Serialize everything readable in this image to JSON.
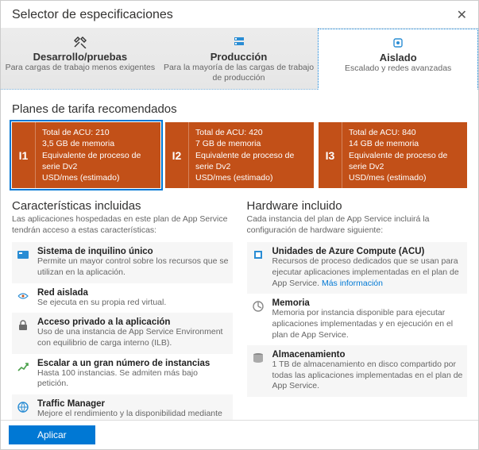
{
  "title": "Selector de especificaciones",
  "tabs": [
    {
      "title": "Desarrollo/pruebas",
      "sub": "Para cargas de trabajo menos exigentes"
    },
    {
      "title": "Producción",
      "sub": "Para la mayoría de las cargas de trabajo de producción"
    },
    {
      "title": "Aislado",
      "sub": "Escalado y redes avanzadas"
    }
  ],
  "recommended_heading": "Planes de tarifa recomendados",
  "plans": [
    {
      "code": "I1",
      "l1": "Total de ACU: 210",
      "l2": "3,5 GB de memoria",
      "l3": "Equivalente de proceso de serie Dv2",
      "l4": "USD/mes (estimado)"
    },
    {
      "code": "I2",
      "l1": "Total de ACU: 420",
      "l2": "7 GB de memoria",
      "l3": "Equivalente de proceso de serie Dv2",
      "l4": "USD/mes (estimado)"
    },
    {
      "code": "I3",
      "l1": "Total de ACU: 840",
      "l2": "14 GB de memoria",
      "l3": "Equivalente de proceso de serie Dv2",
      "l4": "USD/mes (estimado)"
    }
  ],
  "features": {
    "head": "Características incluidas",
    "sub": "Las aplicaciones hospedadas en este plan de App Service tendrán acceso a estas características:",
    "items": [
      {
        "t": "Sistema de inquilino único",
        "d": "Permite un mayor control sobre los recursos que se utilizan en la aplicación."
      },
      {
        "t": "Red aislada",
        "d": "Se ejecuta en su propia red virtual."
      },
      {
        "t": "Acceso privado a la aplicación",
        "d": "Uso de una instancia de App Service Environment con equilibrio de carga interno (ILB)."
      },
      {
        "t": "Escalar a un gran número de instancias",
        "d": "Hasta 100 instancias. Se admiten más bajo petición."
      },
      {
        "t": "Traffic Manager",
        "d": "Mejore el rendimiento y la disponibilidad mediante el enrutamiento del tráfico entre varias instancias de la aplicación."
      }
    ]
  },
  "hardware": {
    "head": "Hardware incluido",
    "sub": "Cada instancia del plan de App Service incluirá la configuración de hardware siguiente:",
    "items": [
      {
        "t": "Unidades de Azure Compute (ACU)",
        "d": "Recursos de proceso dedicados que se usan para ejecutar aplicaciones implementadas en el plan de App Service. ",
        "link": "Más información"
      },
      {
        "t": "Memoria",
        "d": "Memoria por instancia disponible para ejecutar aplicaciones implementadas y en ejecución en el plan de App Service."
      },
      {
        "t": "Almacenamiento",
        "d": "1 TB de almacenamiento en disco compartido por todas las aplicaciones implementadas en el plan de App Service."
      }
    ]
  },
  "apply": "Aplicar"
}
